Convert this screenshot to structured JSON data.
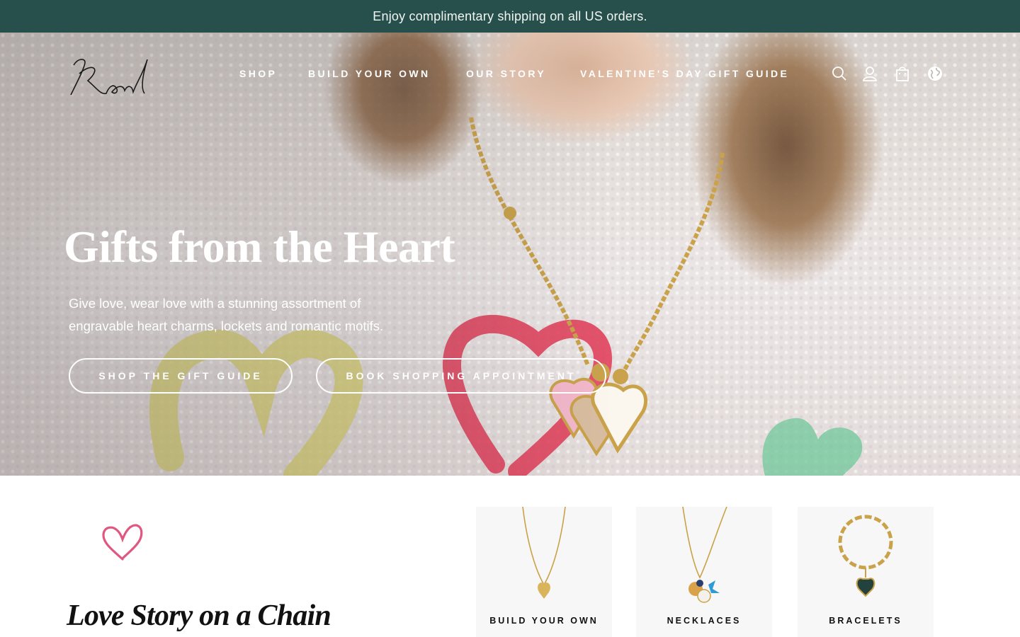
{
  "announcement": {
    "text": "Enjoy complimentary shipping on all US orders."
  },
  "brand": {
    "logo_text": "Randel"
  },
  "nav": {
    "items": [
      {
        "label": "SHOP"
      },
      {
        "label": "BUILD YOUR OWN"
      },
      {
        "label": "OUR STORY"
      },
      {
        "label": "VALENTINE'S DAY GIFT GUIDE"
      }
    ],
    "icons": [
      "search-icon",
      "account-icon",
      "shopping-bag-icon",
      "globe-icon"
    ]
  },
  "hero": {
    "title": "Gifts from the Heart",
    "subtitle_line1": "Give love, wear love with a stunning assortment of",
    "subtitle_line2": "engravable heart charms, lockets and romantic motifs.",
    "primary_button": "SHOP THE GIFT GUIDE",
    "secondary_button": "BOOK SHOPPING APPOINTMENT"
  },
  "section": {
    "heading": "Love Story on a Chain"
  },
  "categories": [
    {
      "label": "BUILD YOUR OWN"
    },
    {
      "label": "NECKLACES"
    },
    {
      "label": "BRACELETS"
    }
  ],
  "colors": {
    "announcement_bg": "#27504d",
    "announcement_text": "#f1f5f3",
    "hero_text": "#ffffff",
    "card_bg": "#f6f7f6",
    "heart_doodle": "#e0577f",
    "gold": "#c9a24a"
  }
}
